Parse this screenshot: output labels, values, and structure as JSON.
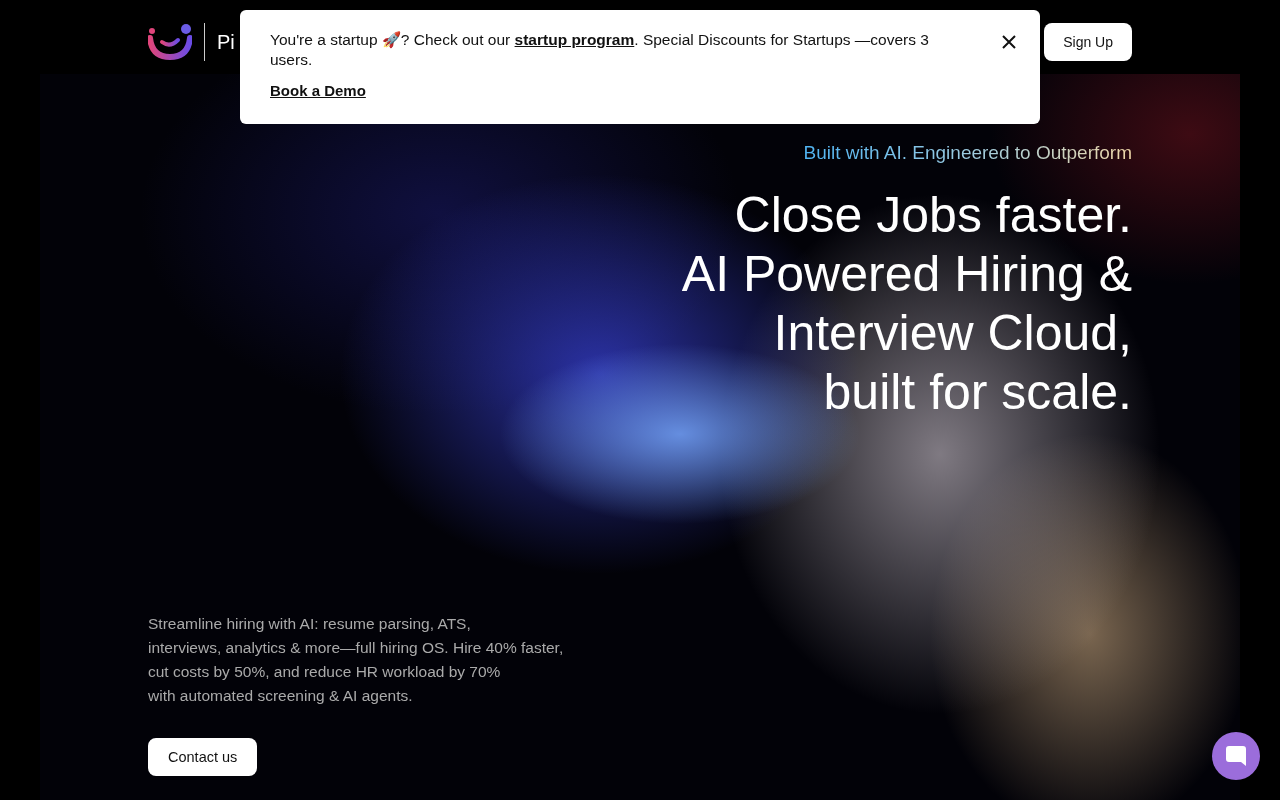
{
  "header": {
    "brand": "Pi",
    "sign_up": "Sign Up"
  },
  "banner": {
    "text_before": "You're a startup 🚀? Check out our",
    "link": "startup program",
    "text_after": ". Special Discounts for Startups —covers 3 users.",
    "cta": "Book a Demo"
  },
  "hero": {
    "tagline": "Built with AI. Engineered to Outperform",
    "headline": [
      "Close Jobs faster.",
      "AI Powered Hiring &",
      "Interview Cloud,",
      "built for scale."
    ],
    "description": [
      "Streamline hiring with AI: resume parsing, ATS,",
      "interviews, analytics & more—full hiring OS. Hire 40% faster,",
      "cut costs by 50%, and reduce HR workload by 70%",
      "with automated screening & AI agents."
    ],
    "contact": "Contact us"
  }
}
